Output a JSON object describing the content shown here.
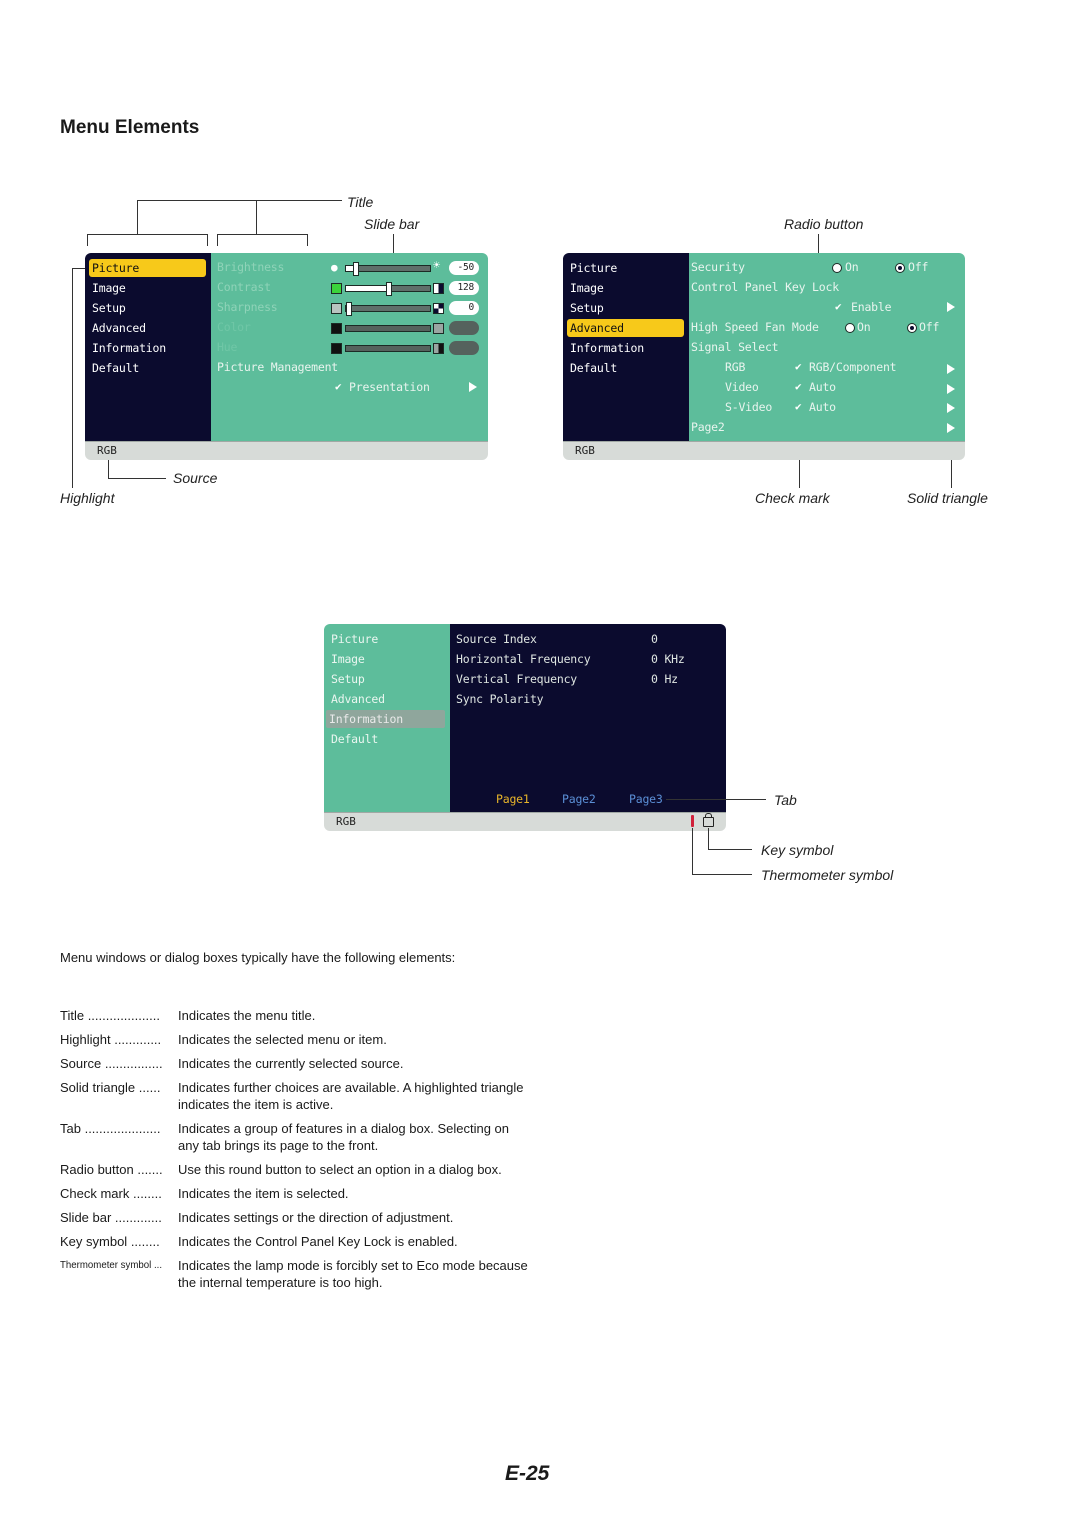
{
  "page": {
    "title": "Menu Elements",
    "page_number": "E-25",
    "intro": "Menu windows or dialog boxes typically have the following elements:"
  },
  "callouts": {
    "title": "Title",
    "slide_bar": "Slide bar",
    "radio_button": "Radio button",
    "source": "Source",
    "highlight": "Highlight",
    "check_mark": "Check mark",
    "solid_triangle": "Solid triangle",
    "tab": "Tab",
    "key_symbol": "Key symbol",
    "thermometer_symbol": "Thermometer symbol"
  },
  "menu1": {
    "nav": [
      "Picture",
      "Image",
      "Setup",
      "Advanced",
      "Information",
      "Default"
    ],
    "selected_nav": "Picture",
    "rows": [
      {
        "label": "Brightness",
        "value": "-50",
        "slider_fraction": 0.1,
        "left_icon": "bulb-dim-icon",
        "right_icon": "bulb-bright-icon"
      },
      {
        "label": "Contrast",
        "value": "128",
        "slider_fraction": 0.5,
        "left_icon": "contrast-low-icon",
        "right_icon": "contrast-high-icon"
      },
      {
        "label": "Sharpness",
        "value": "0",
        "slider_fraction": 0.0,
        "left_icon": "sharpness-low-icon",
        "right_icon": "sharpness-high-icon"
      },
      {
        "label": "Color",
        "value": "",
        "slider_fraction": null,
        "left_icon": "color-low-icon",
        "right_icon": "color-high-icon"
      },
      {
        "label": "Hue",
        "value": "",
        "slider_fraction": null,
        "left_icon": "hue-low-icon",
        "right_icon": "hue-high-icon"
      }
    ],
    "picture_management_label": "Picture Management",
    "picture_management_value": "Presentation",
    "source": "RGB"
  },
  "menu2": {
    "nav": [
      "Picture",
      "Image",
      "Setup",
      "Advanced",
      "Information",
      "Default"
    ],
    "selected_nav": "Advanced",
    "security_label": "Security",
    "security_options": [
      "On",
      "Off"
    ],
    "security_selected": "Off",
    "keylock_label": "Control Panel Key Lock",
    "keylock_value": "Enable",
    "fan_label": "High Speed Fan Mode",
    "fan_options": [
      "On",
      "Off"
    ],
    "fan_selected": "Off",
    "signal_select_label": "Signal Select",
    "signals": [
      {
        "label": "RGB",
        "value": "RGB/Component"
      },
      {
        "label": "Video",
        "value": "Auto"
      },
      {
        "label": "S-Video",
        "value": "Auto"
      }
    ],
    "page2_label": "Page2",
    "source": "RGB"
  },
  "menu3": {
    "nav": [
      "Picture",
      "Image",
      "Setup",
      "Advanced",
      "Information",
      "Default"
    ],
    "selected_nav": "Information",
    "info": [
      {
        "label": "Source Index",
        "value": "0"
      },
      {
        "label": "Horizontal Frequency",
        "value": "0 KHz"
      },
      {
        "label": "Vertical Frequency",
        "value": "0 Hz"
      },
      {
        "label": "Sync Polarity",
        "value": ""
      }
    ],
    "tabs": [
      "Page1",
      "Page2",
      "Page3"
    ],
    "active_tab": "Page1",
    "source": "RGB",
    "colors": {
      "active_tab": "#e8b52a",
      "inactive_tab": "#5b8fd6"
    }
  },
  "definitions": [
    {
      "term": "Title",
      "dots": " ....................",
      "desc": "Indicates the menu title."
    },
    {
      "term": "Highlight",
      "dots": " .............",
      "desc": "Indicates the selected menu or item."
    },
    {
      "term": "Source",
      "dots": " ................",
      "desc": "Indicates the currently selected source."
    },
    {
      "term": "Solid triangle",
      "dots": " ......",
      "desc": "Indicates further choices are available. A highlighted triangle indicates the item is active."
    },
    {
      "term": "Tab",
      "dots": " .....................",
      "desc": "Indicates a group of features in a dialog box. Selecting on any tab brings its page to the front."
    },
    {
      "term": "Radio button",
      "dots": " .......",
      "desc": "Use this round button to select an option in a dialog box."
    },
    {
      "term": "Check mark",
      "dots": " ........",
      "desc": "Indicates the item is selected."
    },
    {
      "term": "Slide bar",
      "dots": " .............",
      "desc": "Indicates settings or the direction of adjustment."
    },
    {
      "term": "Key symbol",
      "dots": " ........",
      "desc": "Indicates the Control Panel Key Lock is enabled."
    },
    {
      "term": "Thermometer symbol",
      "dots": " ...",
      "desc": "Indicates the lamp mode is forcibly set to Eco mode because the internal temperature is too high."
    }
  ]
}
